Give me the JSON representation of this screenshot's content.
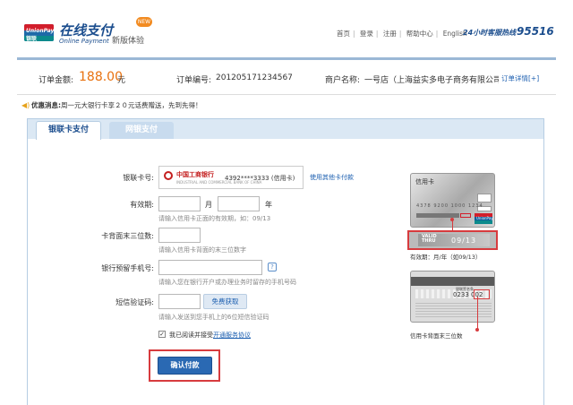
{
  "header": {
    "logo_text": "UnionPay",
    "logo_cn": "银联",
    "brand_cn": "在线支付",
    "brand_en": "Online Payment",
    "new_badge": "NEW",
    "new_version": "新版体验",
    "nav": [
      "首页",
      "登录",
      "注册",
      "帮助中心",
      "English"
    ],
    "hotline_label": "24小时客服热线",
    "hotline_number": "95516"
  },
  "order": {
    "amount_label": "订单金额:",
    "amount": "188.00",
    "amount_unit": "元",
    "number_label": "订单编号:",
    "number": "201205171234567",
    "merchant_label": "商户名称:",
    "merchant": "一号店（上海益实多电子商务有限公司...",
    "detail_link": "订单详情[+]"
  },
  "notice": {
    "title": "优惠消息:",
    "text": "周一元大银行卡享２０元话费赠送，先到先得！"
  },
  "tabs": [
    "银联卡支付",
    "网银支付"
  ],
  "form": {
    "card_label": "银联卡号:",
    "bank_name": "中国工商银行",
    "bank_sub": "INDUSTRIAL AND COMMERCIAL BANK OF CHINA",
    "card_number": "4392****3333 (信用卡)",
    "other_card_link": "使用其他卡付款",
    "expiry_label": "有效期:",
    "month_unit": "月",
    "year_unit": "年",
    "expiry_hint": "请输入信用卡正面的有效期，如：09/13",
    "cvv_label": "卡背面末三位数:",
    "cvv_hint": "请输入信用卡背面的末三位数字",
    "phone_label": "银行预留手机号:",
    "phone_help": "?",
    "phone_hint": "请输入您在银行开户或办理业务时留存的手机号码",
    "sms_label": "短信验证码:",
    "sms_button": "免费获取",
    "sms_hint": "请输入发送到您手机上的6位短信验证码",
    "agree_checked": "✓",
    "agree_text": "我已阅读并接受",
    "agree_link": "开通服务协议",
    "confirm_button": "确认付款"
  },
  "illustration": {
    "front_title": "信用卡",
    "front_numbers": "4378  9200  1000  1234",
    "front_logo": "UnionPay",
    "valid_thru": "VALID THRU",
    "valid_date": "09/13",
    "valid_caption": "有效期：月/年（如09/13）",
    "back_sig": "银联签名条",
    "back_cvv": "0233 002",
    "back_caption": "信用卡背面末三位数"
  },
  "colors": {
    "brand_blue": "#1c4e8e",
    "amount_orange": "#e8710f",
    "highlight_red": "#d73b3e",
    "button_blue": "#2a69b3"
  }
}
